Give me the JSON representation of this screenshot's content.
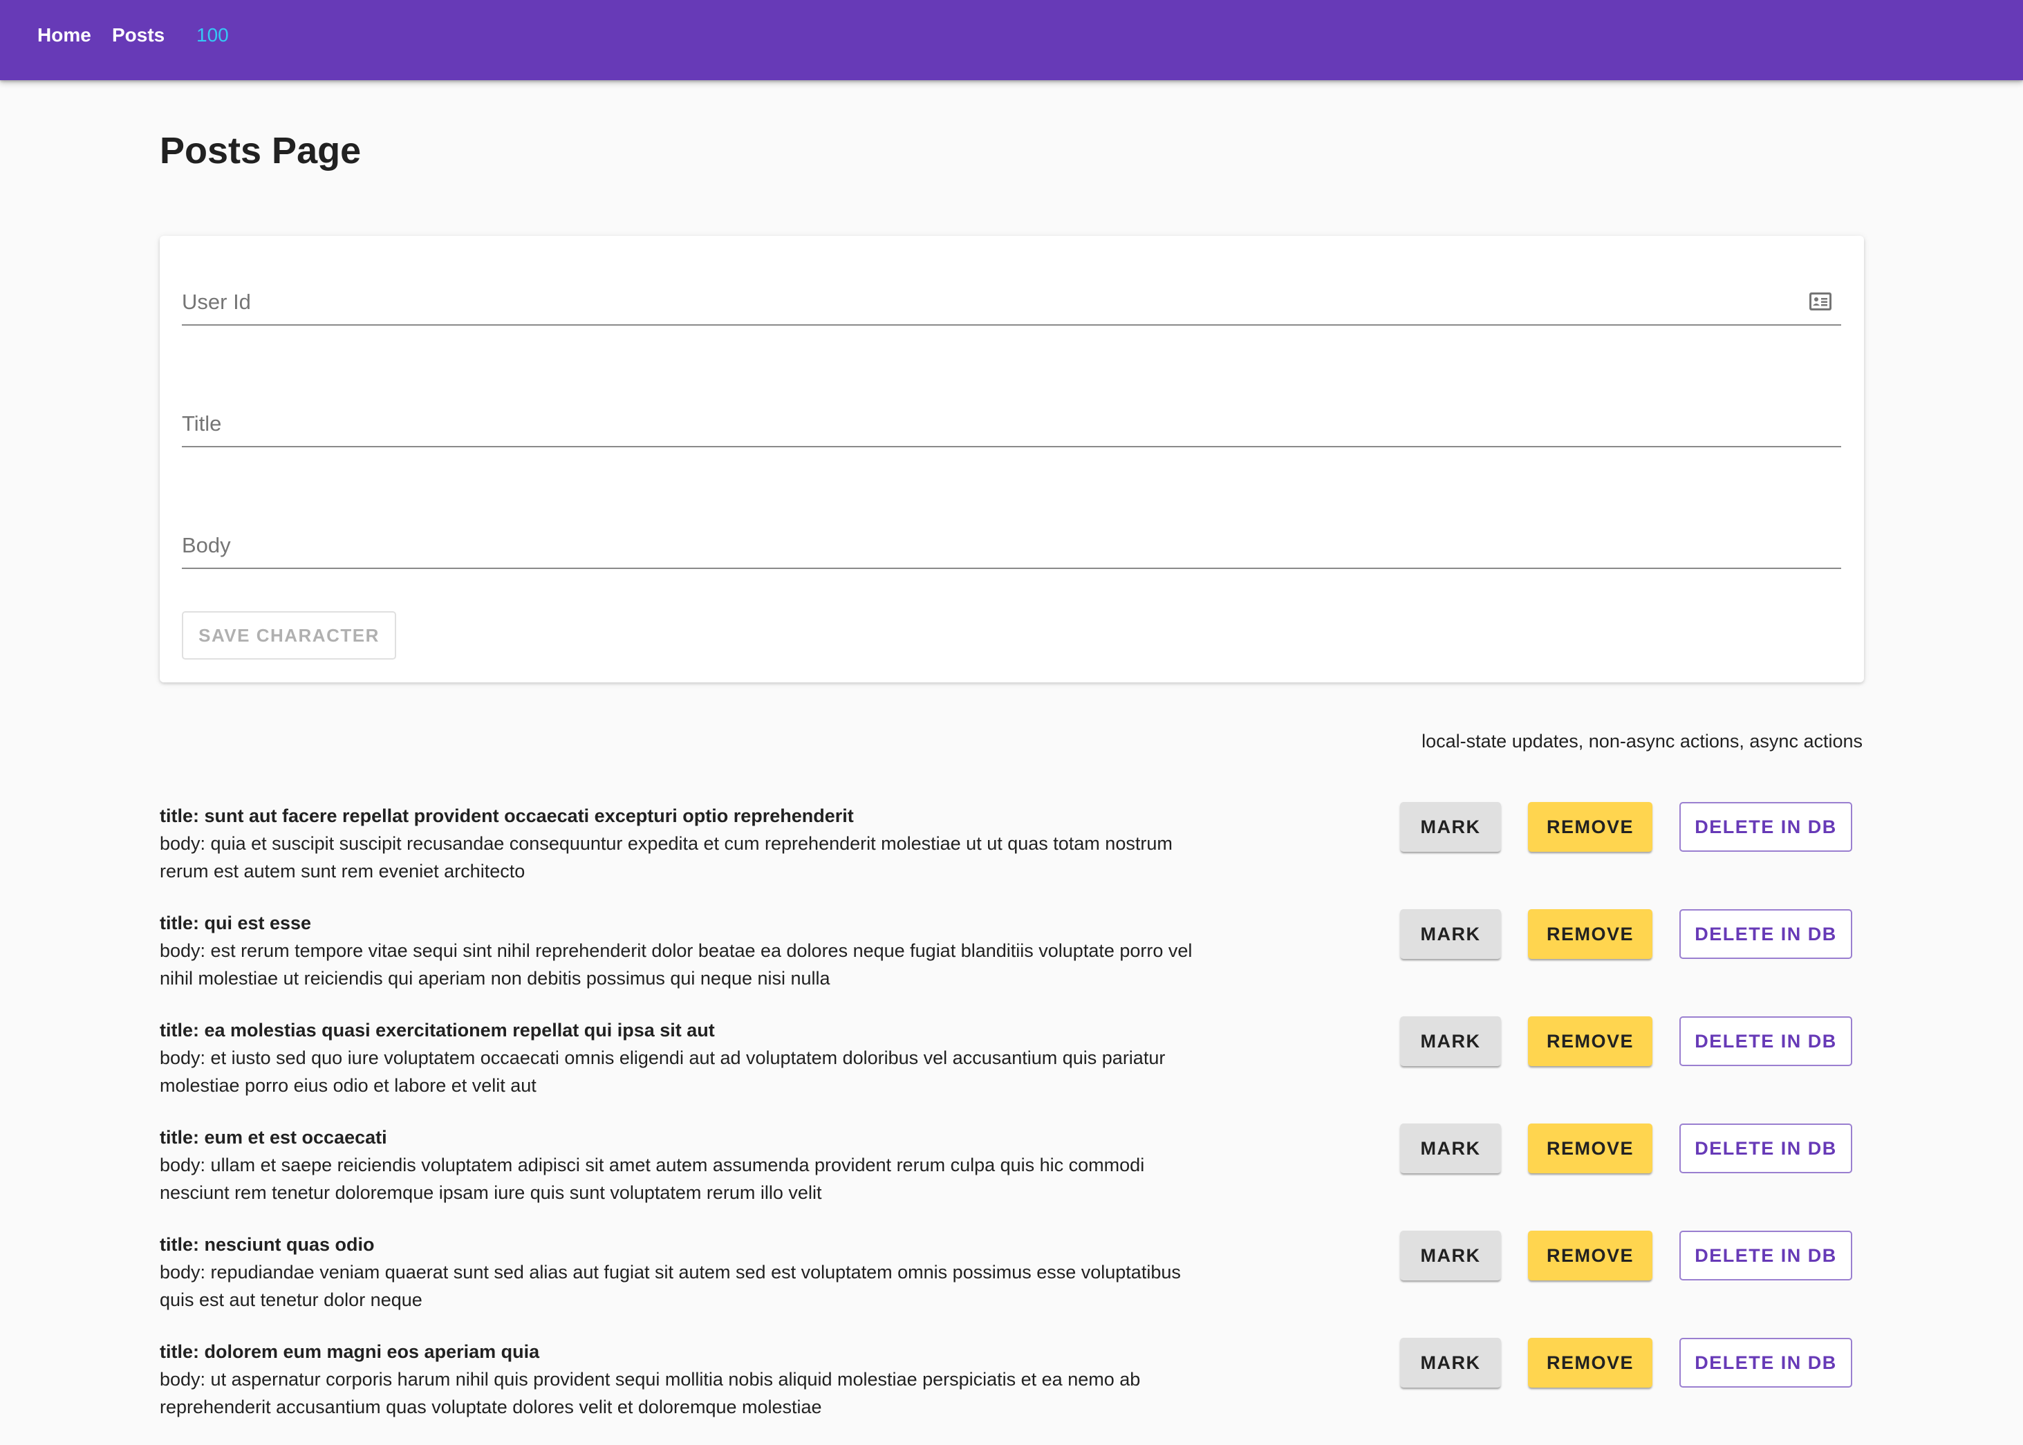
{
  "nav": {
    "home_label": "Home",
    "posts_label": "Posts",
    "counter": "100"
  },
  "page": {
    "title": "Posts Page"
  },
  "form": {
    "user_id_placeholder": "User Id",
    "title_placeholder": "Title",
    "body_placeholder": "Body",
    "user_id_icon": "contact-card-icon",
    "save_label": "SAVE CHARACTER"
  },
  "actions_caption": "local-state updates, non-async actions, async actions",
  "buttons": {
    "mark": "MARK",
    "remove": "REMOVE",
    "delete": "DELETE IN DB"
  },
  "colors": {
    "appbar": "#673ab7",
    "counter": "#35c8f5",
    "remove_button": "#ffd54f",
    "mark_button": "#e0e0e0",
    "delete_button_text": "#673ab7"
  },
  "posts": [
    {
      "title": "title: sunt aut facere repellat provident occaecati excepturi optio reprehenderit",
      "body": "body: quia et suscipit suscipit recusandae consequuntur expedita et cum reprehenderit molestiae ut ut quas totam nostrum rerum est autem sunt rem eveniet architecto"
    },
    {
      "title": "title: qui est esse",
      "body": "body: est rerum tempore vitae sequi sint nihil reprehenderit dolor beatae ea dolores neque fugiat blanditiis voluptate porro vel nihil molestiae ut reiciendis qui aperiam non debitis possimus qui neque nisi nulla"
    },
    {
      "title": "title: ea molestias quasi exercitationem repellat qui ipsa sit aut",
      "body": "body: et iusto sed quo iure voluptatem occaecati omnis eligendi aut ad voluptatem doloribus vel accusantium quis pariatur molestiae porro eius odio et labore et velit aut"
    },
    {
      "title": "title: eum et est occaecati",
      "body": "body: ullam et saepe reiciendis voluptatem adipisci sit amet autem assumenda provident rerum culpa quis hic commodi nesciunt rem tenetur doloremque ipsam iure quis sunt voluptatem rerum illo velit"
    },
    {
      "title": "title: nesciunt quas odio",
      "body": "body: repudiandae veniam quaerat sunt sed alias aut fugiat sit autem sed est voluptatem omnis possimus esse voluptatibus quis est aut tenetur dolor neque"
    },
    {
      "title": "title: dolorem eum magni eos aperiam quia",
      "body": "body: ut aspernatur corporis harum nihil quis provident sequi mollitia nobis aliquid molestiae perspiciatis et ea nemo ab reprehenderit accusantium quas voluptate dolores velit et doloremque molestiae"
    }
  ]
}
